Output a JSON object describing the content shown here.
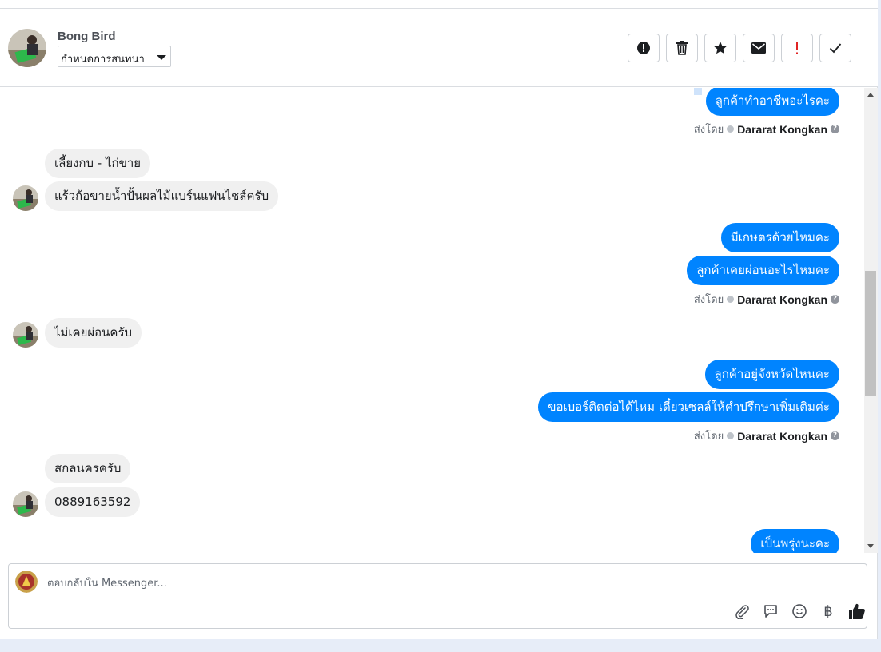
{
  "header": {
    "contact_name": "Bong Bird",
    "assign_label": "กำหนดการสนทนา",
    "toolbar": [
      {
        "name": "report-spam-button",
        "icon": "alert-circle-icon"
      },
      {
        "name": "delete-button",
        "icon": "trash-icon"
      },
      {
        "name": "star-button",
        "icon": "star-icon"
      },
      {
        "name": "mark-unread-button",
        "icon": "envelope-icon"
      },
      {
        "name": "follow-up-button",
        "icon": "exclamation-icon"
      },
      {
        "name": "mark-done-button",
        "icon": "checkmark-icon"
      }
    ]
  },
  "messages": {
    "out_1": "ลูกค้าทำอาชีพอะไรคะ",
    "in_1": "เลี้ยงกบ - ไก่ขาย",
    "in_2": "แร้วก้อขายน้ำปั้นผลไม้แบร์นแฟนไชส์ครับ",
    "out_2": "มีเกษตรด้วยไหมคะ",
    "out_3": "ลูกค้าเคยผ่อนอะไรไหมคะ",
    "in_3": "ไม่เคยผ่อนครับ",
    "out_4": "ลูกค้าอยู่จังหวัดไหนคะ",
    "out_5": "ขอเบอร์ติดต่อได้ไหม เดี๋ยวเซลล์ให้คำปรึกษาเพิ่มเติมค่ะ",
    "in_4": "สกลนครครับ",
    "in_5": "0889163592",
    "out_6": "เป็นพรุ่งนะคะ"
  },
  "sent_by": {
    "prefix": "ส่งโดย",
    "agent": "Dararat Kongkan"
  },
  "composer": {
    "placeholder": "ตอบกลับใน Messenger...",
    "tools": [
      "paperclip-icon",
      "chat-bubble-icon",
      "smiley-icon",
      "baht-icon",
      "thumbs-up-icon"
    ],
    "baht_symbol": "฿"
  },
  "colors": {
    "outgoing_bubble": "#0084ff",
    "incoming_bubble": "#f0f0f0",
    "follow_up_red": "#e02424"
  }
}
